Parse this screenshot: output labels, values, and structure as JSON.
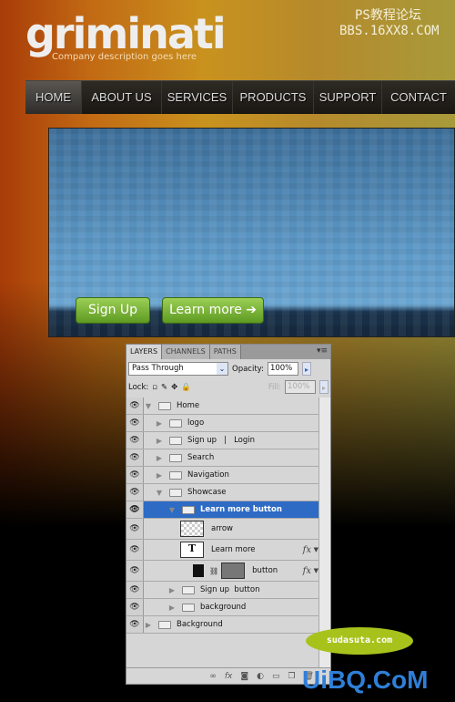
{
  "site": {
    "logo": "griminati",
    "tagline": "Company description goes here",
    "nav": [
      "HOME",
      "ABOUT US",
      "SERVICES",
      "PRODUCTS",
      "SUPPORT",
      "CONTACT"
    ],
    "active": "HOME",
    "buttons": {
      "signup": "Sign Up",
      "learn_more": "Learn more",
      "learn_more_icon": "arrow-right-icon"
    }
  },
  "watermarks": {
    "top_line1": "PS教程论坛",
    "top_line2": "BBS.16XX8.COM",
    "bubble": "sudasuta.com",
    "bottom": "UiBQ.CoM"
  },
  "panel": {
    "tabs": [
      "LAYERS",
      "CHANNELS",
      "PATHS"
    ],
    "blend_mode": "Pass Through",
    "opacity_label": "Opacity:",
    "opacity": "100%",
    "lock_label": "Lock:",
    "fill_label": "Fill:",
    "fill": "100%",
    "layers": [
      {
        "name": "Home",
        "type": "group",
        "expanded": true,
        "depth": 0
      },
      {
        "name": "logo",
        "type": "group",
        "depth": 1
      },
      {
        "name": "Sign up   |   Login",
        "type": "group",
        "depth": 1
      },
      {
        "name": "Search",
        "type": "group",
        "depth": 1
      },
      {
        "name": "Navigation",
        "type": "group",
        "depth": 1
      },
      {
        "name": "Showcase",
        "type": "group",
        "expanded": true,
        "depth": 1
      },
      {
        "name": "Learn more button",
        "type": "group",
        "expanded": true,
        "depth": 2,
        "selected": true
      },
      {
        "name": "arrow",
        "type": "smart-object",
        "depth": 3
      },
      {
        "name": "Learn more",
        "type": "text",
        "depth": 3,
        "fx": "fx"
      },
      {
        "name": "button",
        "type": "shape",
        "depth": 3,
        "fx": "fx"
      },
      {
        "name": "Sign up  button",
        "type": "group",
        "depth": 2
      },
      {
        "name": "background",
        "type": "group",
        "depth": 2
      },
      {
        "name": "Background",
        "type": "group",
        "depth": 0
      }
    ],
    "accent": "#2e6bc4"
  }
}
